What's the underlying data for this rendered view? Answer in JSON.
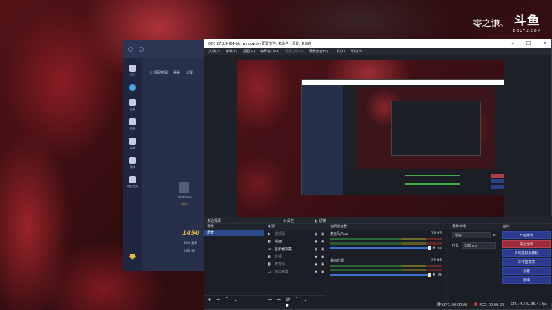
{
  "watermark": {
    "text": "零之谦、",
    "logo": "斗鱼",
    "sub": "DOUYU.COM"
  },
  "bg_app": {
    "tabs": [
      "比赛服务器",
      "哥哥",
      "比赛"
    ],
    "sidebar": [
      "首页",
      "",
      "好友",
      "消息",
      "商城",
      "游戏",
      "特权工具"
    ],
    "user_name": "UNKNOWN…",
    "user_status": "四排人",
    "score": "1450",
    "rows": [
      {
        "label": "胜率",
        "value": "54%"
      },
      {
        "label": "KD",
        "value": "0.98"
      }
    ]
  },
  "obs": {
    "title": "OBS 27.2.4 (64-bit, windows) - 配置文件: 未命名 - 场景: 未命名",
    "window_buttons": [
      "–",
      "☐",
      "✕"
    ],
    "menu": [
      "文件(F)",
      "编辑(E)",
      "视图(V)",
      "停靠窗口(D)",
      "配置文件(P)",
      "场景集合(S)",
      "工具(T)",
      "帮助(H)"
    ],
    "source_bar": {
      "label": "未选择源",
      "props": "属性",
      "filters": "滤镜"
    },
    "scenes": {
      "title": "场景",
      "items": [
        "场景"
      ]
    },
    "sources": {
      "title": "来源",
      "items": [
        {
          "icon": "▶",
          "label": "视频源",
          "active": false
        },
        {
          "icon": "◐",
          "label": "桌面",
          "active": true
        },
        {
          "icon": "▭",
          "label": "显示器采集",
          "active": true
        },
        {
          "icon": "◐",
          "label": "音频",
          "active": false
        },
        {
          "icon": "◐",
          "label": "麦克风",
          "active": false
        },
        {
          "icon": "▭",
          "label": "窗口采集",
          "active": false
        }
      ]
    },
    "mixer": {
      "title": "音频混音器",
      "channels": [
        {
          "name": "麦克风/Aux",
          "db": "0.0 dB"
        },
        {
          "name": "桌面音频",
          "db": "0.0 dB"
        }
      ]
    },
    "transitions": {
      "title": "场景转场",
      "selected": "渐变",
      "duration_label": "时长",
      "duration": "300 ms"
    },
    "controls": {
      "title": "控件",
      "buttons": [
        {
          "label": "开始推流",
          "style": "blue"
        },
        {
          "label": "停止录制",
          "style": "red"
        },
        {
          "label": "启动虚拟摄像机",
          "style": "blue"
        },
        {
          "label": "工作室模式",
          "style": "blue"
        },
        {
          "label": "设置",
          "style": "blue"
        },
        {
          "label": "退出",
          "style": "blue"
        }
      ]
    },
    "status": {
      "live": "LIVE: 00:00:00",
      "rec": "REC: 00:00:00",
      "cpu": "CPU: 4.5%, 35.41 fps"
    }
  }
}
